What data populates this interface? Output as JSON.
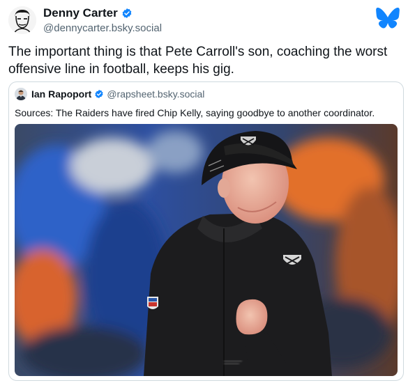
{
  "post": {
    "author_name": "Denny Carter",
    "author_handle": "@dennycarter.bsky.social",
    "text": "The important thing is that Pete Carroll's son, coaching the worst offensive line in football, keeps his gig."
  },
  "quoted_post": {
    "author_name": "Ian Rapoport",
    "author_handle": "@rapsheet.bsky.social",
    "text": "Sources: The Raiders have fired Chip Kelly, saying goodbye to another coordinator."
  },
  "icons": {
    "verified": "verified-badge-icon",
    "platform": "bluesky-butterfly-icon"
  },
  "colors": {
    "accent_blue": "#1185fe",
    "text_primary": "#0f1419",
    "text_secondary": "#536471",
    "border": "#cfd9de"
  }
}
